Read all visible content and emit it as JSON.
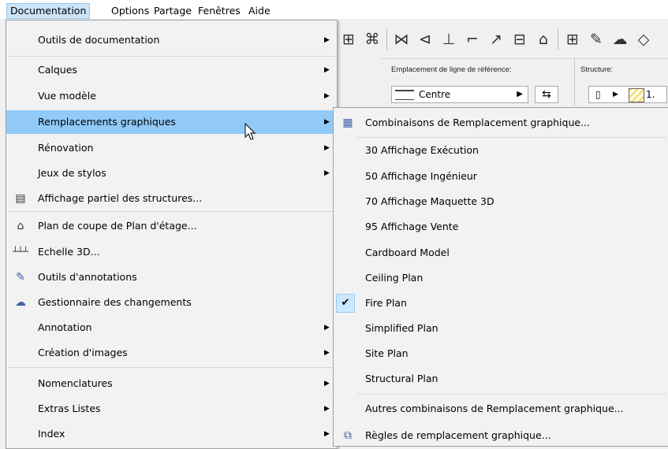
{
  "menubar": {
    "items": [
      "Documentation",
      "Options",
      "Partage",
      "Fenêtres",
      "Aide"
    ]
  },
  "toolbar": {
    "ref_line_label": "Emplacement de ligne de référence:",
    "ref_line_value": "Centre",
    "structure_label": "Structure:",
    "structure_value": "1."
  },
  "menu": {
    "items": [
      {
        "label": "Outils de documentation",
        "submenu": true
      },
      {
        "label": "Calques",
        "submenu": true
      },
      {
        "label": "Vue modèle",
        "submenu": true
      },
      {
        "label": "Remplacements graphiques",
        "submenu": true,
        "highlighted": true
      },
      {
        "label": "Rénovation",
        "submenu": true
      },
      {
        "label": "Jeux de stylos",
        "submenu": true
      },
      {
        "label": "Affichage partiel des structures...",
        "icon": "partial-structure-icon"
      },
      {
        "label": "Plan de coupe de Plan d'étage...",
        "icon": "floor-plan-cut-icon"
      },
      {
        "label": "Echelle 3D...",
        "icon": "scale-3d-icon"
      },
      {
        "label": "Outils d'annotations",
        "icon": "annotation-pen-icon"
      },
      {
        "label": "Gestionnaire des changements",
        "icon": "change-manager-icon"
      },
      {
        "label": "Annotation",
        "submenu": true
      },
      {
        "label": "Création d'images",
        "submenu": true
      },
      {
        "label": "Nomenclatures",
        "submenu": true
      },
      {
        "label": "Extras Listes",
        "submenu": true
      },
      {
        "label": "Index",
        "submenu": true
      }
    ]
  },
  "submenu": {
    "items": [
      {
        "label": "Combinaisons de Remplacement graphique...",
        "icon": "override-combinations-icon"
      },
      {
        "label": "30 Affichage Exécution"
      },
      {
        "label": "50 Affichage Ingénieur"
      },
      {
        "label": "70 Affichage Maquette 3D"
      },
      {
        "label": "95 Affichage Vente"
      },
      {
        "label": "Cardboard Model"
      },
      {
        "label": "Ceiling Plan"
      },
      {
        "label": "Fire Plan",
        "checked": true
      },
      {
        "label": "Simplified Plan"
      },
      {
        "label": "Site Plan"
      },
      {
        "label": "Structural Plan"
      },
      {
        "label": "Autres combinaisons de Remplacement graphique..."
      },
      {
        "label": "Règles de remplacement graphique...",
        "icon": "override-rules-icon"
      }
    ]
  }
}
